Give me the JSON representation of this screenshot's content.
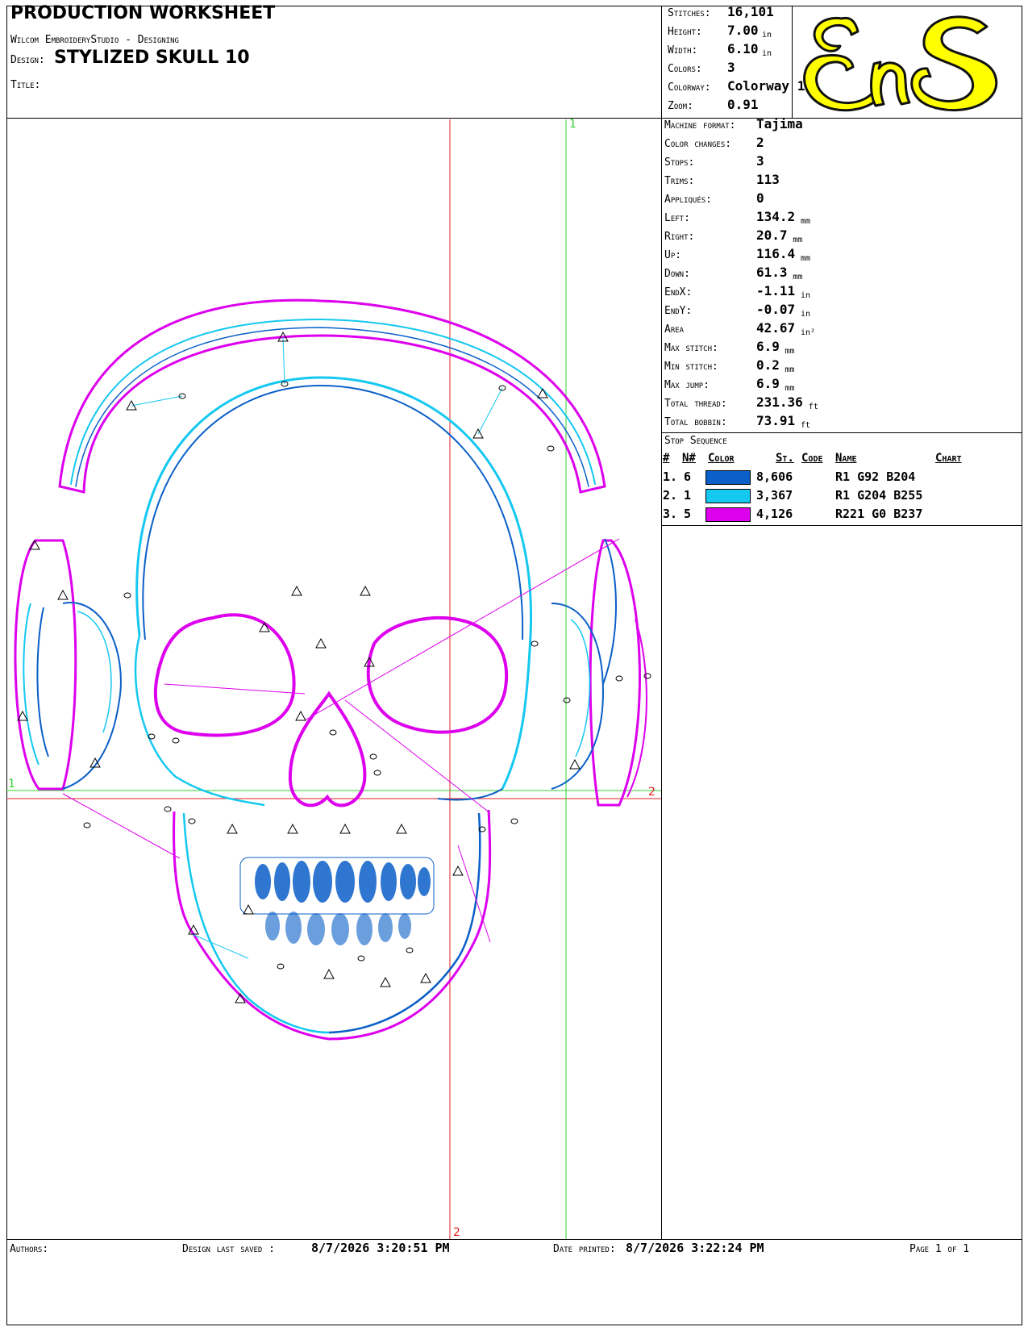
{
  "header": {
    "title": "PRODUCTION WORKSHEET",
    "software": "Wilcom EmbroideryStudio - Designing",
    "design_label": "Design:",
    "design_name": "STYLIZED SKULL  10",
    "title_label": "Title:"
  },
  "summary": [
    {
      "label": "Stitches:",
      "value": "16,101",
      "unit": ""
    },
    {
      "label": "Height:",
      "value": "7.00",
      "unit": "in"
    },
    {
      "label": "Width:",
      "value": "6.10",
      "unit": "in"
    },
    {
      "label": "Colors:",
      "value": "3",
      "unit": ""
    },
    {
      "label": "Colorway:",
      "value": "Colorway 1",
      "unit": ""
    },
    {
      "label": "Zoom:",
      "value": "0.91",
      "unit": ""
    }
  ],
  "logo": {
    "text": "EnS",
    "colors": {
      "fill": "#ffff00",
      "stroke": "#111111"
    }
  },
  "machine_info": [
    {
      "label": "Machine format:",
      "value": "Tajima",
      "unit": ""
    },
    {
      "label": "Color changes:",
      "value": "2",
      "unit": ""
    },
    {
      "label": "Stops:",
      "value": "3",
      "unit": ""
    },
    {
      "label": "Trims:",
      "value": "113",
      "unit": ""
    },
    {
      "label": "Appliqués:",
      "value": "0",
      "unit": ""
    },
    {
      "label": "Left:",
      "value": "134.2",
      "unit": "mm"
    },
    {
      "label": "Right:",
      "value": "20.7",
      "unit": "mm"
    },
    {
      "label": "Up:",
      "value": "116.4",
      "unit": "mm"
    },
    {
      "label": "Down:",
      "value": "61.3",
      "unit": "mm"
    },
    {
      "label": "EndX:",
      "value": "-1.11",
      "unit": "in"
    },
    {
      "label": "EndY:",
      "value": "-0.07",
      "unit": "in"
    },
    {
      "label": "Area",
      "value": "42.67",
      "unit": "in²"
    },
    {
      "label": "Max stitch:",
      "value": "6.9",
      "unit": "mm"
    },
    {
      "label": "Min stitch:",
      "value": "0.2",
      "unit": "mm"
    },
    {
      "label": "Max jump:",
      "value": "6.9",
      "unit": "mm"
    },
    {
      "label": "Total thread:",
      "value": "231.36",
      "unit": "ft"
    },
    {
      "label": "Total bobbin:",
      "value": "73.91",
      "unit": "ft"
    }
  ],
  "stop_sequence": {
    "title": "Stop Sequence",
    "headers": {
      "num": "#",
      "needle": "N#",
      "color": "Color",
      "stitches": "St.",
      "code": "Code",
      "name": "Name",
      "chart": "Chart"
    },
    "rows": [
      {
        "num": "1.",
        "needle": "6",
        "color": "#0a5fc8",
        "stitches": "8,606",
        "name": "R1 G92 B204"
      },
      {
        "num": "2.",
        "needle": "1",
        "color": "#14c8f0",
        "stitches": "3,367",
        "name": "R1 G204 B255"
      },
      {
        "num": "3.",
        "needle": "5",
        "color": "#dd00ed",
        "stitches": "4,126",
        "name": "R221 G0 B237"
      }
    ]
  },
  "guides": {
    "label_1": "1",
    "label_2": "2"
  },
  "footer": {
    "authors_label": "Authors:",
    "last_saved_label": "Design last saved :",
    "last_saved": "8/7/2026 3:20:51 PM",
    "printed_label": "Date printed:",
    "printed": "8/7/2026 3:22:24 PM",
    "page": "Page 1 of 1"
  },
  "colors": {
    "dark_blue": "#0a5fc8",
    "cyan": "#14c8f0",
    "magenta": "#dd00ed",
    "guide_red": "#e02020",
    "guide_green": "#30d030"
  }
}
